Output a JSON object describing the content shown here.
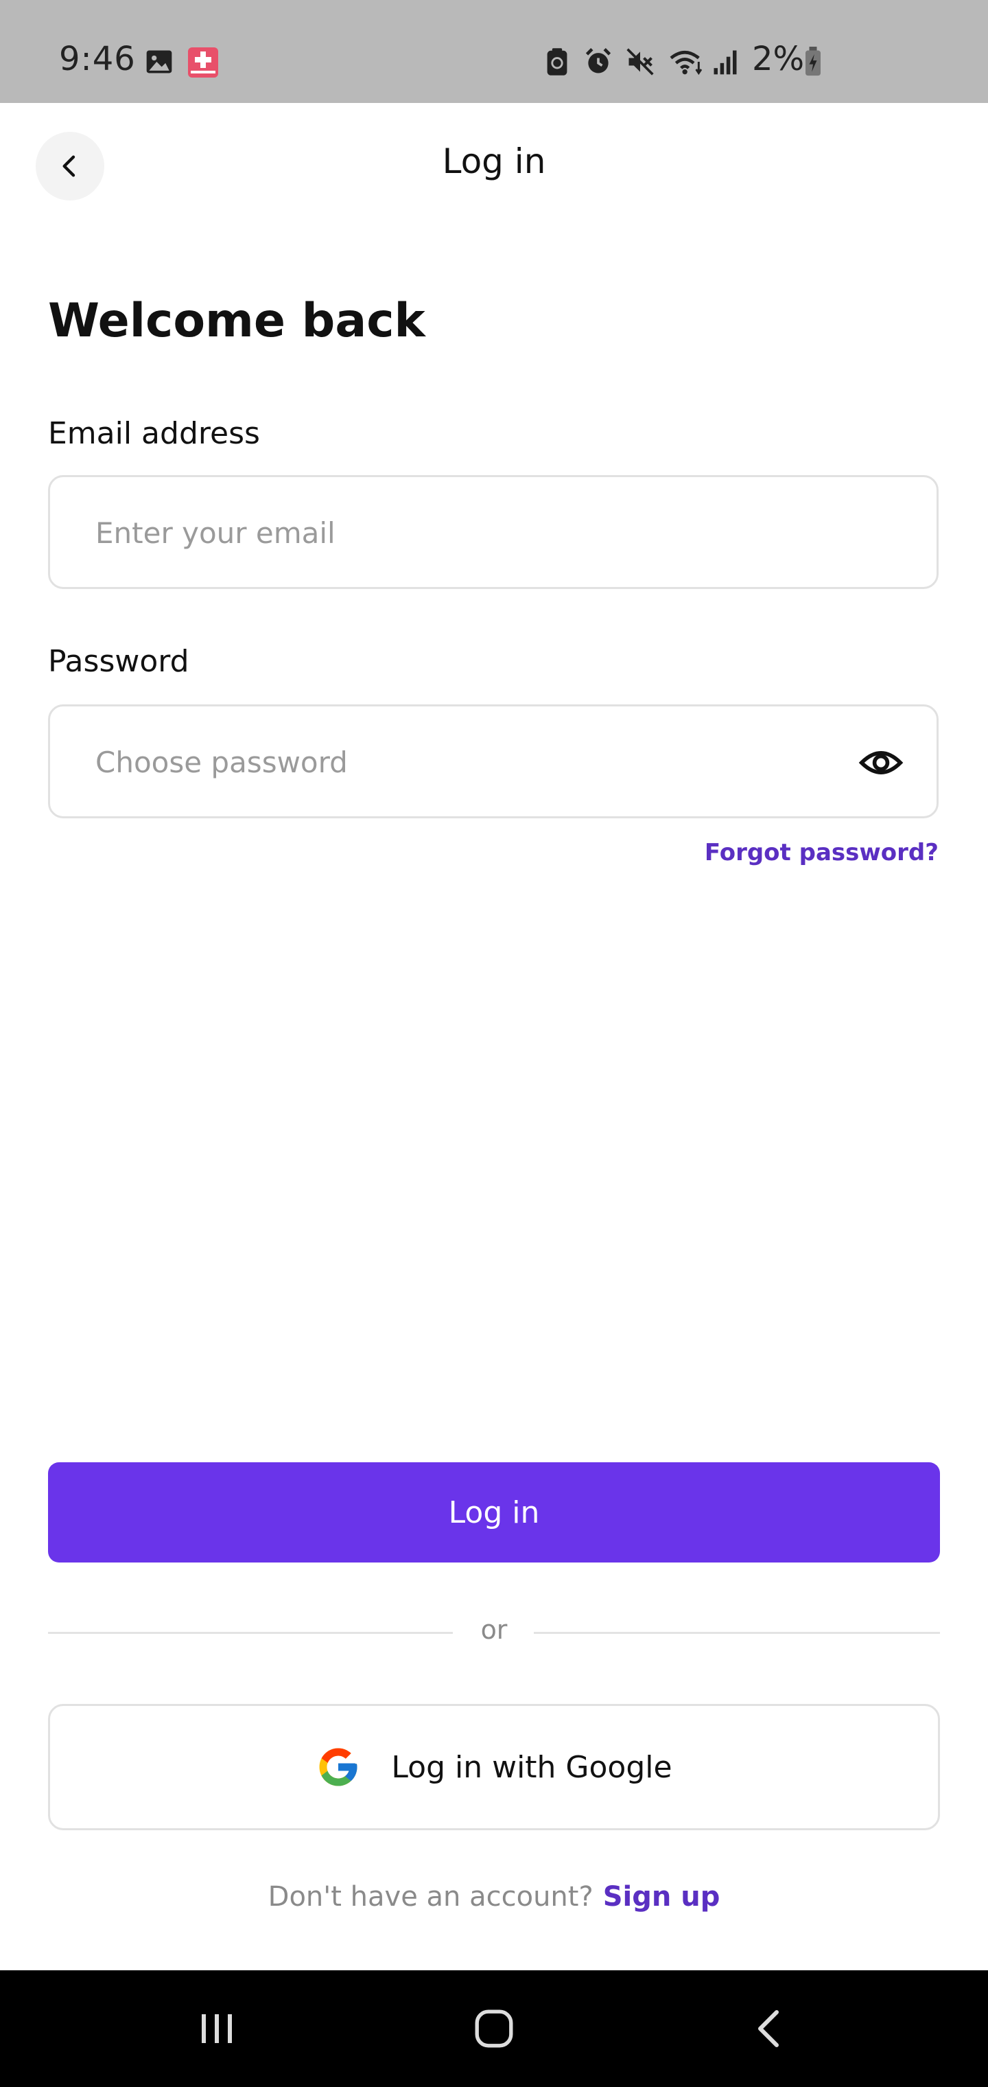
{
  "status_bar": {
    "time": "9:46",
    "battery_text": "2%",
    "icons": [
      "image-icon",
      "medical-app-icon",
      "recycle-icon",
      "alarm-icon",
      "mute-icon",
      "wifi-icon",
      "signal-icon",
      "battery-charging-icon"
    ]
  },
  "header": {
    "title": "Log in",
    "back_icon": "chevron-left-icon"
  },
  "main": {
    "heading": "Welcome back",
    "email": {
      "label": "Email address",
      "placeholder": "Enter your email",
      "value": ""
    },
    "password": {
      "label": "Password",
      "placeholder": "Choose password",
      "value": "",
      "toggle_icon": "eye-icon"
    },
    "forgot_password": "Forgot password?",
    "login_button": "Log in",
    "divider_text": "or",
    "google_button": "Log in with Google",
    "signup_prompt": "Don't have an account?",
    "signup_link": "Sign up"
  },
  "colors": {
    "accent": "#6a34ea",
    "link": "#5a2fc2",
    "status_bar_bg": "#b9b9b9",
    "nav_bar_bg": "#000000"
  },
  "nav_bar": {
    "icons": [
      "recent-apps-icon",
      "home-icon",
      "back-icon"
    ]
  }
}
